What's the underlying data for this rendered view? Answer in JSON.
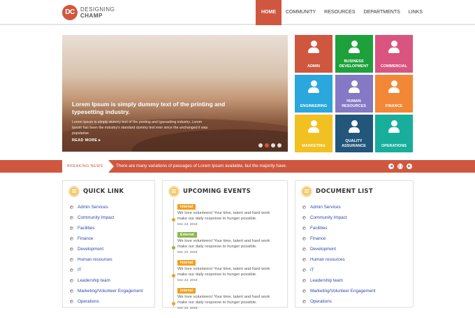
{
  "logo": {
    "mark": "DC",
    "line1": "DESIGNING",
    "line2": "CHAMP"
  },
  "nav": [
    {
      "label": "HOME",
      "active": true
    },
    {
      "label": "COMMUNITY"
    },
    {
      "label": "RESOURCES"
    },
    {
      "label": "DEPARTMENTS"
    },
    {
      "label": "LINKS"
    }
  ],
  "hero": {
    "title": "Lorem Ipsum is simply dummy text of the printing and typesetting industry.",
    "description": "Lorem Ipsum is simply dummy text of the printing and typesetting industry. Lorem Ipsum has been the industry's standard dummy text ever since the unchanged it was popularise.",
    "more_label": "READ MORE",
    "more_icon": "arrow-right-icon"
  },
  "tiles": [
    {
      "label": "ADMIN",
      "color": "#d0573f"
    },
    {
      "label": "BUSINESS DEVELOPMENT",
      "color": "#1ea13c"
    },
    {
      "label": "COMMERCIAL",
      "color": "#d9557f"
    },
    {
      "label": "ENGINEERING",
      "color": "#2aa7dd"
    },
    {
      "label": "HUMAN RESOURCES",
      "color": "#8578c4"
    },
    {
      "label": "FINANCE",
      "color": "#f28737"
    },
    {
      "label": "MARKETING",
      "color": "#f1c021"
    },
    {
      "label": "QUALITY ASSURANCE",
      "color": "#23567b"
    },
    {
      "label": "OPERATIONS",
      "color": "#17ae9c"
    }
  ],
  "breaking": {
    "tag": "BREAKING NEWS",
    "text": "There are many variations of passages of Lorem Ipsum available, but the majority have."
  },
  "quick_link": {
    "title": "QUICK LINK",
    "items": [
      "Admin Services",
      "Community Impact",
      "Facilities",
      "Finance",
      "Development",
      "Human resources",
      "IT",
      "Leadership team",
      "Marketing/Volunteer Engagement",
      "Operations"
    ]
  },
  "events": {
    "title": "UPCOMING EVENTS",
    "items": [
      {
        "tag": "Internal",
        "tag_color": "#f0a024",
        "text": "We love volunteers! Your time, talent and hard work make our daily response to hunger possible.",
        "date": "Dec 22, 2018"
      },
      {
        "tag": "External",
        "tag_color": "#8cb84a",
        "text": "We love volunteers! Your time, talent and hard work make our daily response to hunger possible.",
        "date": "Dec 22, 2018"
      },
      {
        "tag": "Internal",
        "tag_color": "#f0a024",
        "text": "We love volunteers! Your time, talent and hard work make our daily response to hunger possible.",
        "date": "Dec 22, 2018"
      },
      {
        "tag": "Internal",
        "tag_color": "#f0a024",
        "text": "We love volunteers! Your time, talent and hard work make our daily response to hunger possible.",
        "date": "Dec 22, 2018"
      }
    ]
  },
  "documents": {
    "title": "DOCUMENT LIST",
    "items": [
      "Admin Services",
      "Community Impact",
      "Facilities",
      "Finance",
      "Development",
      "Human resources",
      "IT",
      "Leadership team",
      "Marketing/Volunteer Engagement",
      "Operations"
    ]
  },
  "colors": {
    "accent": "#d0573f",
    "link": "#2b4aa8"
  }
}
